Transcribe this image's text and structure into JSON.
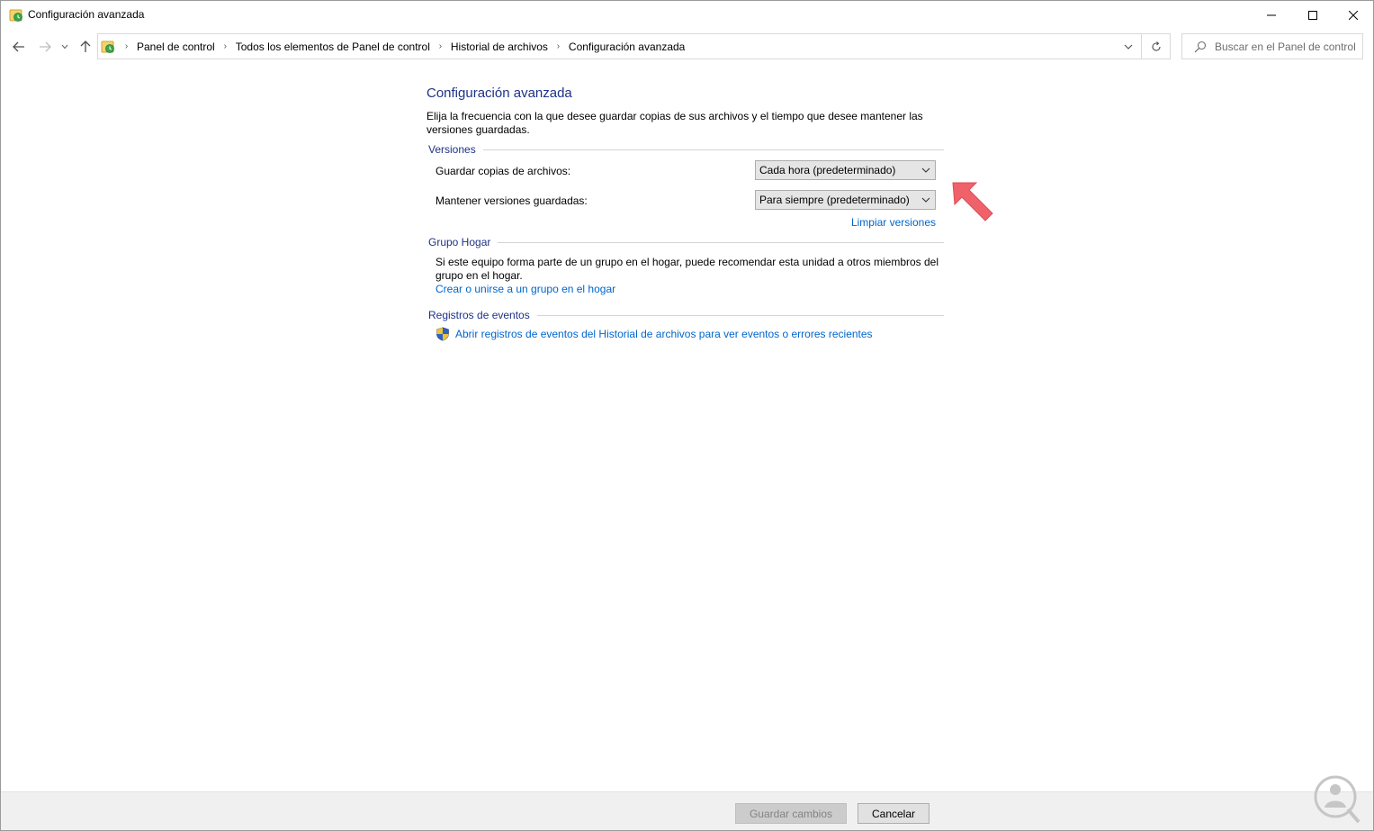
{
  "window": {
    "title": "Configuración avanzada",
    "app_icon": "file-history-icon",
    "controls": [
      "minimize",
      "maximize",
      "close"
    ]
  },
  "navigation": {
    "breadcrumbs": [
      "Panel de control",
      "Todos los elementos de Panel de control",
      "Historial de archivos",
      "Configuración avanzada"
    ],
    "search_placeholder": "Buscar en el Panel de control"
  },
  "page": {
    "title": "Configuración avanzada",
    "description": "Elija la frecuencia con la que desee guardar copias de sus archivos y el tiempo que desee mantener las versiones guardadas.",
    "versions": {
      "header": "Versiones",
      "save_copies_label": "Guardar copias de archivos:",
      "save_copies_value": "Cada hora (predeterminado)",
      "keep_versions_label": "Mantener versiones guardadas:",
      "keep_versions_value": "Para siempre (predeterminado)",
      "clean_link": "Limpiar versiones"
    },
    "homegroup": {
      "header": "Grupo Hogar",
      "text": "Si este equipo forma parte de un grupo en el hogar, puede recomendar esta unidad a otros miembros del grupo en el hogar.",
      "link": "Crear o unirse a un grupo en el hogar"
    },
    "events": {
      "header": "Registros de eventos",
      "link": "Abrir registros de eventos del Historial de archivos para ver eventos o errores recientes"
    }
  },
  "footer": {
    "save_label": "Guardar cambios",
    "cancel_label": "Cancelar"
  },
  "colors": {
    "title_blue": "#1e3287",
    "link_blue": "#0066cc",
    "annotation_arrow": "#f0626a"
  }
}
